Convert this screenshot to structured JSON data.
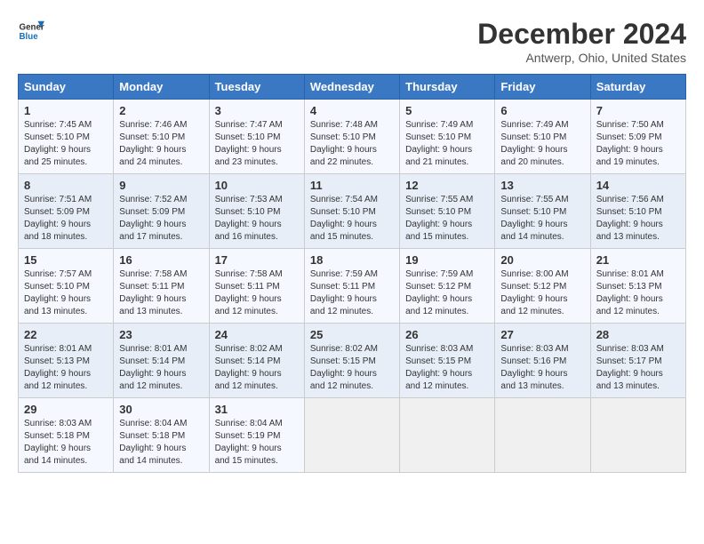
{
  "logo": {
    "line1": "General",
    "line2": "Blue"
  },
  "title": "December 2024",
  "subtitle": "Antwerp, Ohio, United States",
  "days_header": [
    "Sunday",
    "Monday",
    "Tuesday",
    "Wednesday",
    "Thursday",
    "Friday",
    "Saturday"
  ],
  "weeks": [
    [
      {
        "day": "1",
        "sunrise": "7:45 AM",
        "sunset": "5:10 PM",
        "daylight": "9 hours and 25 minutes."
      },
      {
        "day": "2",
        "sunrise": "7:46 AM",
        "sunset": "5:10 PM",
        "daylight": "9 hours and 24 minutes."
      },
      {
        "day": "3",
        "sunrise": "7:47 AM",
        "sunset": "5:10 PM",
        "daylight": "9 hours and 23 minutes."
      },
      {
        "day": "4",
        "sunrise": "7:48 AM",
        "sunset": "5:10 PM",
        "daylight": "9 hours and 22 minutes."
      },
      {
        "day": "5",
        "sunrise": "7:49 AM",
        "sunset": "5:10 PM",
        "daylight": "9 hours and 21 minutes."
      },
      {
        "day": "6",
        "sunrise": "7:49 AM",
        "sunset": "5:10 PM",
        "daylight": "9 hours and 20 minutes."
      },
      {
        "day": "7",
        "sunrise": "7:50 AM",
        "sunset": "5:09 PM",
        "daylight": "9 hours and 19 minutes."
      }
    ],
    [
      {
        "day": "8",
        "sunrise": "7:51 AM",
        "sunset": "5:09 PM",
        "daylight": "9 hours and 18 minutes."
      },
      {
        "day": "9",
        "sunrise": "7:52 AM",
        "sunset": "5:09 PM",
        "daylight": "9 hours and 17 minutes."
      },
      {
        "day": "10",
        "sunrise": "7:53 AM",
        "sunset": "5:10 PM",
        "daylight": "9 hours and 16 minutes."
      },
      {
        "day": "11",
        "sunrise": "7:54 AM",
        "sunset": "5:10 PM",
        "daylight": "9 hours and 15 minutes."
      },
      {
        "day": "12",
        "sunrise": "7:55 AM",
        "sunset": "5:10 PM",
        "daylight": "9 hours and 15 minutes."
      },
      {
        "day": "13",
        "sunrise": "7:55 AM",
        "sunset": "5:10 PM",
        "daylight": "9 hours and 14 minutes."
      },
      {
        "day": "14",
        "sunrise": "7:56 AM",
        "sunset": "5:10 PM",
        "daylight": "9 hours and 13 minutes."
      }
    ],
    [
      {
        "day": "15",
        "sunrise": "7:57 AM",
        "sunset": "5:10 PM",
        "daylight": "9 hours and 13 minutes."
      },
      {
        "day": "16",
        "sunrise": "7:58 AM",
        "sunset": "5:11 PM",
        "daylight": "9 hours and 13 minutes."
      },
      {
        "day": "17",
        "sunrise": "7:58 AM",
        "sunset": "5:11 PM",
        "daylight": "9 hours and 12 minutes."
      },
      {
        "day": "18",
        "sunrise": "7:59 AM",
        "sunset": "5:11 PM",
        "daylight": "9 hours and 12 minutes."
      },
      {
        "day": "19",
        "sunrise": "7:59 AM",
        "sunset": "5:12 PM",
        "daylight": "9 hours and 12 minutes."
      },
      {
        "day": "20",
        "sunrise": "8:00 AM",
        "sunset": "5:12 PM",
        "daylight": "9 hours and 12 minutes."
      },
      {
        "day": "21",
        "sunrise": "8:01 AM",
        "sunset": "5:13 PM",
        "daylight": "9 hours and 12 minutes."
      }
    ],
    [
      {
        "day": "22",
        "sunrise": "8:01 AM",
        "sunset": "5:13 PM",
        "daylight": "9 hours and 12 minutes."
      },
      {
        "day": "23",
        "sunrise": "8:01 AM",
        "sunset": "5:14 PM",
        "daylight": "9 hours and 12 minutes."
      },
      {
        "day": "24",
        "sunrise": "8:02 AM",
        "sunset": "5:14 PM",
        "daylight": "9 hours and 12 minutes."
      },
      {
        "day": "25",
        "sunrise": "8:02 AM",
        "sunset": "5:15 PM",
        "daylight": "9 hours and 12 minutes."
      },
      {
        "day": "26",
        "sunrise": "8:03 AM",
        "sunset": "5:15 PM",
        "daylight": "9 hours and 12 minutes."
      },
      {
        "day": "27",
        "sunrise": "8:03 AM",
        "sunset": "5:16 PM",
        "daylight": "9 hours and 13 minutes."
      },
      {
        "day": "28",
        "sunrise": "8:03 AM",
        "sunset": "5:17 PM",
        "daylight": "9 hours and 13 minutes."
      }
    ],
    [
      {
        "day": "29",
        "sunrise": "8:03 AM",
        "sunset": "5:18 PM",
        "daylight": "9 hours and 14 minutes."
      },
      {
        "day": "30",
        "sunrise": "8:04 AM",
        "sunset": "5:18 PM",
        "daylight": "9 hours and 14 minutes."
      },
      {
        "day": "31",
        "sunrise": "8:04 AM",
        "sunset": "5:19 PM",
        "daylight": "9 hours and 15 minutes."
      },
      null,
      null,
      null,
      null
    ]
  ]
}
